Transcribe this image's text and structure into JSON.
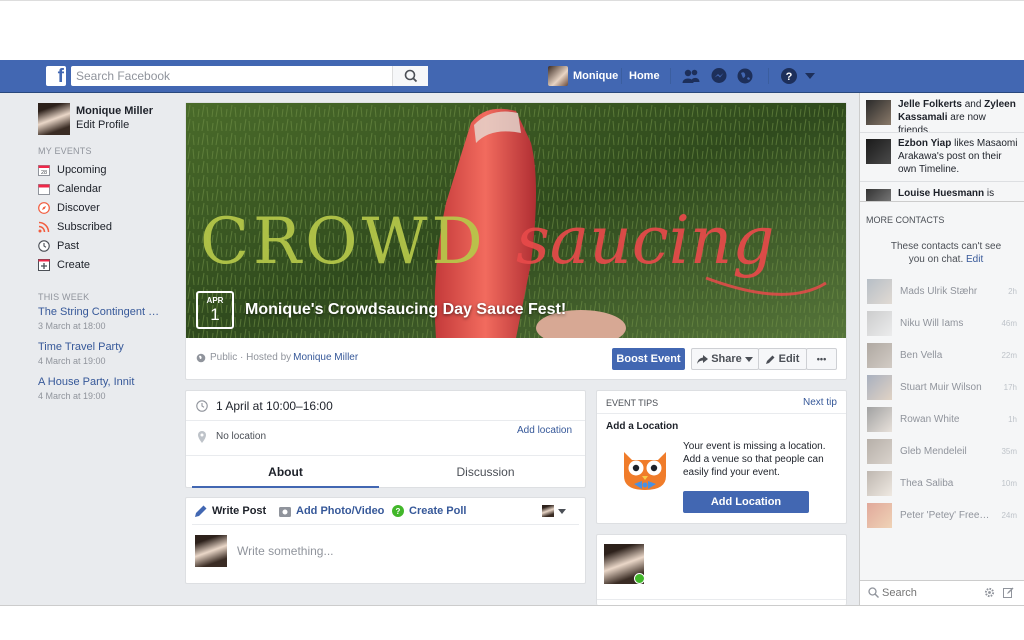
{
  "topnav": {
    "search_placeholder": "Search Facebook",
    "profile_name": "Monique",
    "home_label": "Home",
    "colors": {
      "bar": "#4267b2"
    }
  },
  "left": {
    "profile_name": "Monique Miller",
    "edit_profile": "Edit Profile",
    "my_events_heading": "MY EVENTS",
    "items": [
      {
        "label": "Upcoming",
        "icon": "calendar-28-icon"
      },
      {
        "label": "Calendar",
        "icon": "calendar-icon"
      },
      {
        "label": "Discover",
        "icon": "compass-icon"
      },
      {
        "label": "Subscribed",
        "icon": "rss-icon"
      },
      {
        "label": "Past",
        "icon": "clock-icon"
      },
      {
        "label": "Create",
        "icon": "plus-box-icon"
      }
    ],
    "this_week_heading": "THIS WEEK",
    "this_week": [
      {
        "title": "The String Contingent pla...",
        "date": "3 March at 18:00"
      },
      {
        "title": "Time Travel Party",
        "date": "4 March at 19:00"
      },
      {
        "title": "A House Party, Innit",
        "date": "4 March at 19:00"
      }
    ]
  },
  "event": {
    "cover_text_left": "CROWD",
    "cover_text_right": "saucing",
    "month": "APR",
    "day": "1",
    "title": "Monique's Crowdsaucing Day Sauce Fest!",
    "privacy": "Public · Hosted by ",
    "host": "Monique Miller",
    "boost_label": "Boost Event",
    "share_label": "Share",
    "edit_label": "Edit",
    "more_label": "•••",
    "datetime": "1 April at 10:00–16:00",
    "location": "No location",
    "add_location_link": "Add location",
    "tabs": [
      "About",
      "Discussion"
    ],
    "composer": {
      "write_post": "Write Post",
      "add_photo": "Add Photo/Video",
      "create_poll": "Create Poll",
      "placeholder": "Write something..."
    }
  },
  "tips": {
    "heading": "EVENT TIPS",
    "next_tip": "Next tip",
    "title": "Add a Location",
    "body": "Your event is missing a location. Add a venue so that people can easily find your event.",
    "button": "Add Location"
  },
  "right": {
    "ticker": [
      {
        "bold1": "Jelle Folkerts",
        "text": " and ",
        "bold2": "Zyleen Kassamali",
        "tail": " are now friends."
      },
      {
        "bold1": "Ezbon Yiap",
        "text": " likes Masaomi Arakawa's post on their own Timeline.",
        "bold2": "",
        "tail": ""
      },
      {
        "bold1": "Louise Huesmann",
        "text": " is",
        "bold2": "",
        "tail": ""
      }
    ],
    "more_contacts": "MORE CONTACTS",
    "chat_notice": "These contacts can't see you on chat.",
    "chat_edit": "Edit",
    "contacts": [
      {
        "name": "Mads Ulrik Stæhr",
        "time": "2h"
      },
      {
        "name": "Niku Will Iams",
        "time": "46m"
      },
      {
        "name": "Ben Vella",
        "time": "22m"
      },
      {
        "name": "Stuart Muir Wilson",
        "time": "17h"
      },
      {
        "name": "Rowan White",
        "time": "1h"
      },
      {
        "name": "Gleb Mendeleil",
        "time": "35m"
      },
      {
        "name": "Thea Saliba",
        "time": "10m"
      },
      {
        "name": "Peter 'Petey' Freem...",
        "time": "24m"
      }
    ],
    "search_placeholder": "Search"
  }
}
